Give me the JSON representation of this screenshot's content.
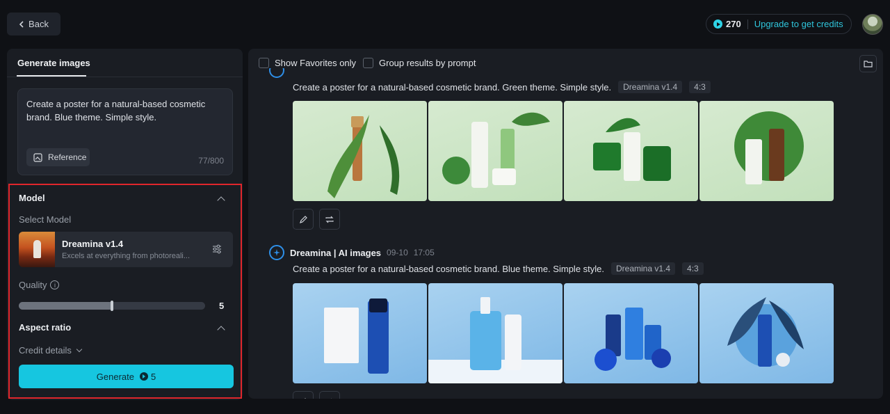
{
  "header": {
    "back_label": "Back",
    "credits_count": "270",
    "upgrade_label": "Upgrade to get credits"
  },
  "left_panel": {
    "tab_label": "Generate images",
    "prompt_text": "Create a poster for a natural-based cosmetic brand. Blue theme. Simple style.",
    "reference_label": "Reference",
    "char_count": "77/800",
    "model_section_title": "Model",
    "select_model_label": "Select Model",
    "model_name": "Dreamina v1.4",
    "model_description": "Excels at everything from photoreali...",
    "quality_label": "Quality",
    "quality_value": "5",
    "quality_fraction": 0.5,
    "aspect_ratio_title": "Aspect ratio",
    "credit_details_label": "Credit details",
    "generate_label": "Generate",
    "generate_cost": "5"
  },
  "right_panel": {
    "show_favorites_label": "Show Favorites only",
    "group_results_label": "Group results by prompt",
    "results": [
      {
        "prompt": "Create a poster for a natural-based cosmetic brand. Green theme. Simple style.",
        "model_tag": "Dreamina v1.4",
        "ratio_tag": "4:3",
        "theme": "green"
      },
      {
        "author": "Dreamina | AI images",
        "date": "09-10",
        "time": "17:05",
        "prompt": "Create a poster for a natural-based cosmetic brand. Blue theme. Simple style.",
        "model_tag": "Dreamina v1.4",
        "ratio_tag": "4:3",
        "theme": "blue"
      }
    ]
  },
  "colors": {
    "accent": "#16c6e0",
    "highlight_border": "#e0262c",
    "panel_bg": "#1a1d23",
    "page_bg": "#0f1115"
  }
}
